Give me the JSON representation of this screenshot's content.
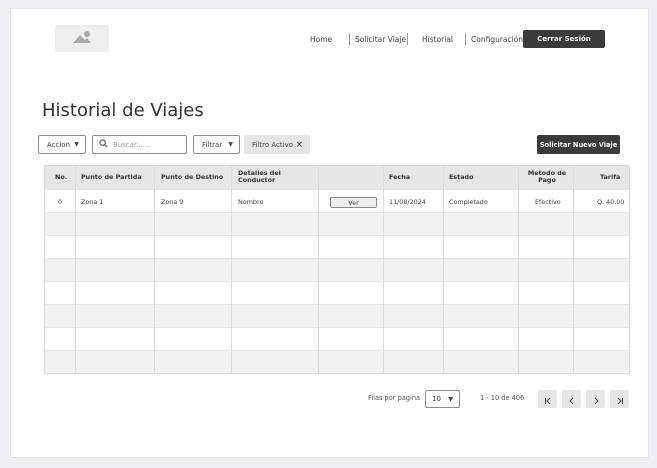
{
  "nav": {
    "home": "Home",
    "request_trip": "Solicitar Viaje",
    "history": "Historial",
    "settings": "Configuración",
    "logout": "Cerrar Sesión"
  },
  "page": {
    "title": "Historial de Viajes"
  },
  "toolbar": {
    "action_label": "Accion",
    "search_placeholder": "Buscar......",
    "filter_label": "Filtrar",
    "active_filter_chip": "Filtro Activo",
    "request_button": "Solicitar Nuevo Viaje"
  },
  "table": {
    "columns": {
      "no": "No.",
      "origin": "Punto de Partida",
      "destination": "Punto de Destino",
      "driver": "Detalles del Conductor",
      "date": "Fecha",
      "status": "Estado",
      "payment": "Metodo de Pago",
      "fare": "Tarifa"
    },
    "rows": [
      {
        "no": "0",
        "origin": "Zona 1",
        "destination": "Zona 9",
        "driver": "Nombre",
        "view_button": "Ver",
        "date": "11/08/2024",
        "status": "Completado",
        "payment": "Efectivo",
        "fare": "Q. 40.00"
      }
    ]
  },
  "pagination": {
    "rows_per_page_label": "Filas por pagina",
    "rows_per_page_value": "10",
    "range": "1 - 10 de 406"
  }
}
